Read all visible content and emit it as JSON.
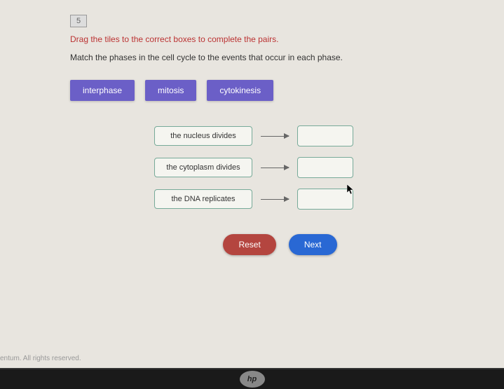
{
  "question_number": "5",
  "instruction_primary": "Drag the tiles to the correct boxes to complete the pairs.",
  "instruction_secondary": "Match the phases in the cell cycle to the events that occur in each phase.",
  "tiles": [
    {
      "label": "interphase"
    },
    {
      "label": "mitosis"
    },
    {
      "label": "cytokinesis"
    }
  ],
  "pairs": [
    {
      "event": "the nucleus divides"
    },
    {
      "event": "the cytoplasm divides"
    },
    {
      "event": "the DNA replicates"
    }
  ],
  "buttons": {
    "reset": "Reset",
    "next": "Next"
  },
  "footer": "entum. All rights reserved.",
  "logo": "hp"
}
